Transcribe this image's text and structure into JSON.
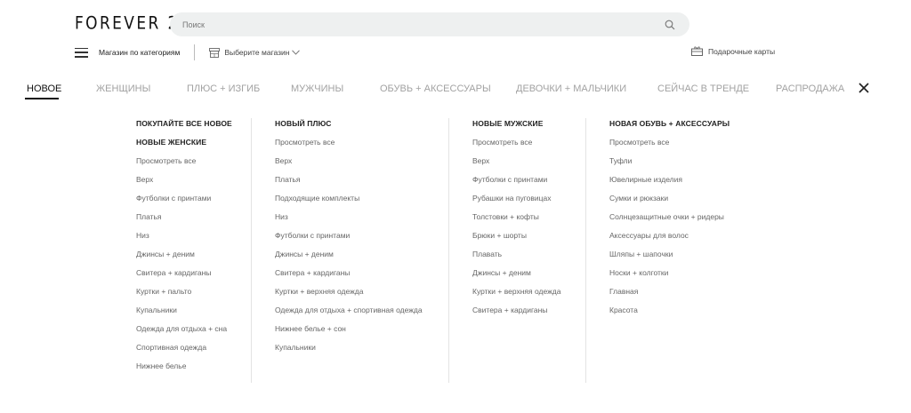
{
  "header": {
    "logo": "FOREVER 21",
    "search_placeholder": "Поиск",
    "shop_by_category": "Магазин по категориям",
    "select_store": "Выберите магазин",
    "gift_cards": "Подарочные карты"
  },
  "nav": {
    "tabs": [
      {
        "label": "НОВОЕ"
      },
      {
        "label": "ЖЕНЩИНЫ"
      },
      {
        "label": "ПЛЮС + ИЗГИБ"
      },
      {
        "label": "МУЖЧИНЫ"
      },
      {
        "label": "ОБУВЬ + АКСЕССУАРЫ"
      },
      {
        "label": "ДЕВОЧКИ + МАЛЬЧИКИ"
      },
      {
        "label": "СЕЙЧАС В ТРЕНДЕ"
      },
      {
        "label": "РАСПРОДАЖА"
      }
    ],
    "active_tab": "НОВОЕ"
  },
  "menu": {
    "columns": [
      {
        "items": [
          {
            "label": "ПОКУПАЙТЕ ВСЕ НОВОЕ",
            "heading": true
          },
          {
            "label": "НОВЫЕ ЖЕНСКИЕ",
            "heading": true
          },
          {
            "label": "Просмотреть все"
          },
          {
            "label": "Верх"
          },
          {
            "label": "Футболки с принтами"
          },
          {
            "label": "Платья"
          },
          {
            "label": "Низ"
          },
          {
            "label": "Джинсы + деним"
          },
          {
            "label": "Свитера + кардиганы"
          },
          {
            "label": "Куртки + пальто"
          },
          {
            "label": "Купальники"
          },
          {
            "label": "Одежда для отдыха + сна"
          },
          {
            "label": "Спортивная одежда"
          },
          {
            "label": "Нижнее белье"
          }
        ]
      },
      {
        "items": [
          {
            "label": "НОВЫЙ ПЛЮС",
            "heading": true
          },
          {
            "label": "Просмотреть все"
          },
          {
            "label": "Верх"
          },
          {
            "label": "Платья"
          },
          {
            "label": "Подходящие комплекты"
          },
          {
            "label": "Низ"
          },
          {
            "label": "Футболки с принтами"
          },
          {
            "label": "Джинсы + деним"
          },
          {
            "label": "Свитера + кардиганы"
          },
          {
            "label": "Куртки + верхняя одежда"
          },
          {
            "label": "Одежда для отдыха + спортивная одежда"
          },
          {
            "label": "Нижнее белье + сон"
          },
          {
            "label": "Купальники"
          }
        ]
      },
      {
        "items": [
          {
            "label": "НОВЫЕ МУЖСКИЕ",
            "heading": true
          },
          {
            "label": "Просмотреть все"
          },
          {
            "label": "Верх"
          },
          {
            "label": "Футболки с принтами"
          },
          {
            "label": "Рубашки на пуговицах"
          },
          {
            "label": "Толстовки + кофты"
          },
          {
            "label": "Брюки + шорты"
          },
          {
            "label": "Плавать"
          },
          {
            "label": "Джинсы + деним"
          },
          {
            "label": "Куртки + верхняя одежда"
          },
          {
            "label": "Свитера + кардиганы"
          }
        ]
      },
      {
        "items": [
          {
            "label": "НОВАЯ ОБУВЬ + АКСЕССУАРЫ",
            "heading": true
          },
          {
            "label": "Просмотреть все"
          },
          {
            "label": "Туфли"
          },
          {
            "label": "Ювелирные изделия"
          },
          {
            "label": "Сумки и рюкзаки"
          },
          {
            "label": "Солнцезащитные очки + ридеры"
          },
          {
            "label": "Аксессуары для волос"
          },
          {
            "label": "Шляпы + шапочки"
          },
          {
            "label": "Носки + колготки"
          },
          {
            "label": "Главная"
          },
          {
            "label": "Красота"
          }
        ]
      }
    ]
  },
  "icons": {
    "search": "search-icon",
    "menu": "hamburger-icon",
    "store": "store-icon",
    "dropdown": "chevron-down-icon",
    "gift": "gift-card-icon",
    "close": "close-icon"
  },
  "colors": {
    "active_text": "#111111",
    "inactive_tab": "#a2a2a2",
    "search_bg": "#eef0f0",
    "link_text": "#666666"
  }
}
